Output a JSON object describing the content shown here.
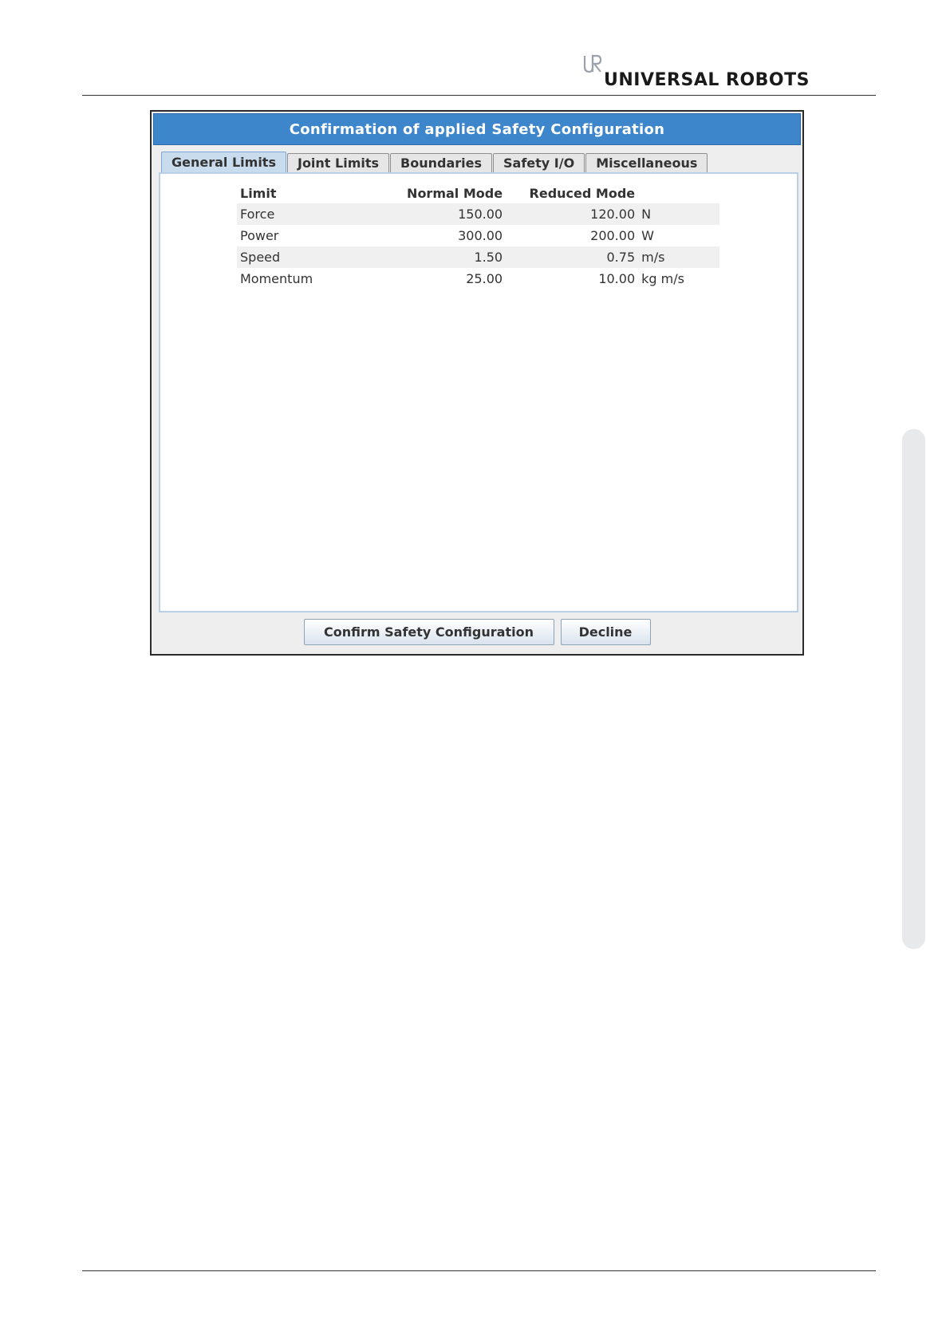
{
  "page_header": {
    "brand": "UNIVERSAL ROBOTS"
  },
  "dialog": {
    "title": "Confirmation of applied Safety Configuration",
    "tabs": [
      {
        "label": "General Limits",
        "active": true
      },
      {
        "label": "Joint Limits",
        "active": false
      },
      {
        "label": "Boundaries",
        "active": false
      },
      {
        "label": "Safety I/O",
        "active": false
      },
      {
        "label": "Miscellaneous",
        "active": false
      }
    ],
    "table": {
      "headers": {
        "limit": "Limit",
        "normal": "Normal Mode",
        "reduced": "Reduced Mode"
      },
      "rows": [
        {
          "limit": "Force",
          "normal": "150.00",
          "reduced": "120.00",
          "unit": "N"
        },
        {
          "limit": "Power",
          "normal": "300.00",
          "reduced": "200.00",
          "unit": "W"
        },
        {
          "limit": "Speed",
          "normal": "1.50",
          "reduced": "0.75",
          "unit": "m/s"
        },
        {
          "limit": "Momentum",
          "normal": "25.00",
          "reduced": "10.00",
          "unit": "kg m/s"
        }
      ]
    },
    "buttons": {
      "confirm": "Confirm Safety Configuration",
      "decline": "Decline"
    }
  },
  "colors": {
    "titlebar": "#3e86cc",
    "active_tab": "#c9dced",
    "panel_border": "#b8d0e8",
    "side_tab": "#e8e9ea"
  }
}
